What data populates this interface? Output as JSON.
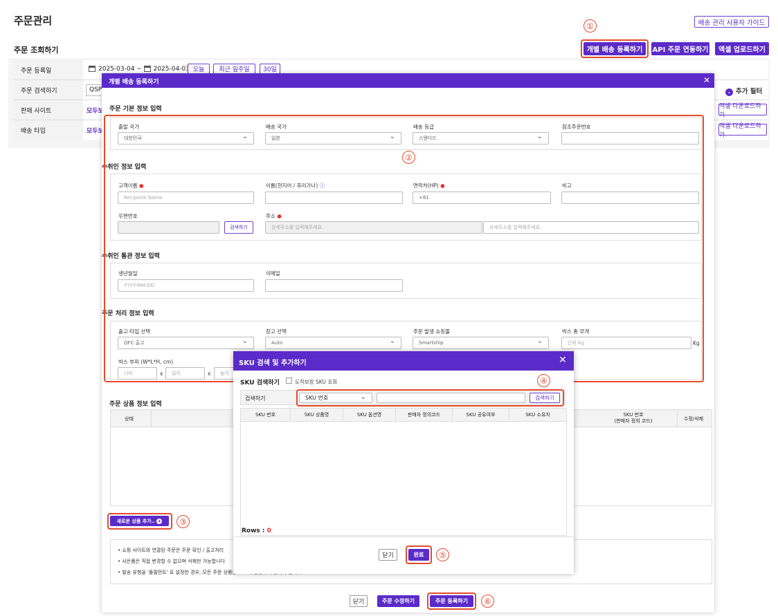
{
  "page": {
    "title": "주문관리",
    "guide_button": "배송 관리 사용자 가이드",
    "subtitle": "주문 조회하기",
    "btn_register": "개별 배송 등록하기",
    "btn_api": "API 주문 연동하기",
    "btn_excel": "엑셀 업로드하기"
  },
  "filters": {
    "date_label": "주문 등록일",
    "date_from": "2025-03-04",
    "date_sep": "~",
    "date_to": "2025-04-03",
    "today": "오늘",
    "week": "최근 일주일",
    "month": "30일",
    "search_label": "주문 검색하기",
    "search_value": "QSP",
    "site_label": "판매 사이트",
    "site_value": "모두보",
    "type_label": "배송 타입",
    "type_value": "모두보",
    "extra_filter": "추가 필터",
    "download1": "엑셀 다운로드하기",
    "download2": "엑셀 다운로드하기"
  },
  "modal": {
    "title": "개별 배송 등록하기",
    "close": "✕",
    "basic": {
      "title": "주문 기본 정보 입력",
      "origin_label": "출발 국가",
      "origin_value": "대한민국",
      "dest_label": "배송 국가",
      "dest_value": "일본",
      "grade_label": "배송 등급",
      "grade_value": "스탠다드",
      "ref_label": "참조주문번호"
    },
    "recipient": {
      "title": "수취인 정보 입력",
      "name_label": "고객이름",
      "name_ph": "Recipient Name",
      "local_label": "이름(현지어 / 후리가나)",
      "phone_label": "연락처(HP)",
      "phone_value": "+81",
      "memo_label": "비고",
      "zip_label": "우편번호",
      "search_btn": "검색하기",
      "addr_label": "주소",
      "addr_ph1": "상세주소를 입력해주세요.",
      "addr_ph2": "상세주소를 입력해주세요."
    },
    "customs": {
      "title": "수취인 통관 정보 입력",
      "birth_label": "생년월일",
      "birth_ph": "YYYY-MM-DD",
      "email_label": "이메일"
    },
    "process": {
      "title": "주문 처리 정보 입력",
      "out_label": "출고 타입 선택",
      "out_value": "QFC 출고",
      "wh_label": "창고 선택",
      "wh_value": "Auto",
      "shop_label": "주문 발생 쇼핑몰",
      "shop_value": "Smartship",
      "weight_label": "박스 총 무게",
      "weight_ph": "단위 Kg",
      "weight_unit": "Kg",
      "vol_label": "박스 부피 (W*L*H, cm)",
      "w_ph": "너비",
      "l_ph": "길이",
      "h_ph": "높이",
      "x": "x"
    },
    "products": {
      "title": "주문 상품 정보 입력",
      "col_status": "상태",
      "col_sku": "SKU 번호\n(판매자 정의 코드)",
      "col_edit": "수정/삭제",
      "add_btn": "새로운 상품 추가..",
      "notes": [
        "• 쇼핑 사이트와 연결된 주문은 주문 확인 / 출고처리",
        "• 사은품은 직접 변경할 수 없으며 삭제만 가능합니다",
        "• 발송 유형을 '풀필먼트' 로 설정한 경우, 모든 주문 상품은 SKU가 연동되어 있어야 합니다"
      ]
    },
    "footer": {
      "close": "닫기",
      "edit": "주문 수정하기",
      "register": "주문 등록하기"
    }
  },
  "sku": {
    "title": "SKU 검색 및 추가하기",
    "close": "✕",
    "search_title": "SKU 검색하기",
    "checkbox": "도착보장 SKU 조회",
    "search_label": "검색하기",
    "select_value": "SKU 번호",
    "search_btn": "검색하기",
    "cols": [
      "SKU 번호",
      "SKU 상품명",
      "SKU 옵션명",
      "판매자 정의코드",
      "SKU 공유여부",
      "SKU 소유자"
    ],
    "rows_label": "Rows : ",
    "rows_value": "0",
    "close_btn": "닫기",
    "done_btn": "완료"
  },
  "markers": [
    "①",
    "②",
    "③",
    "④",
    "⑤",
    "⑥"
  ],
  "colors": {
    "accent": "#5b2bc9",
    "highlight": "#e34b2d"
  }
}
